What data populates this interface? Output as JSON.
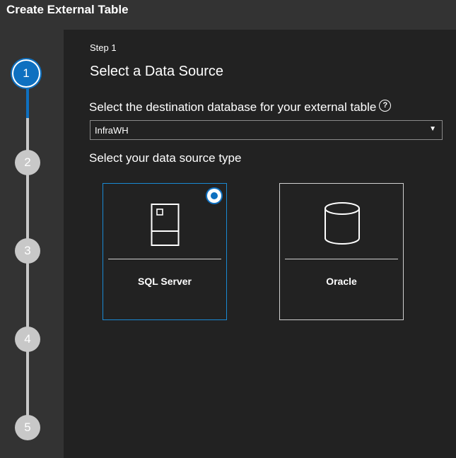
{
  "window": {
    "title": "Create External Table"
  },
  "stepper": {
    "steps": [
      {
        "number": "1",
        "state": "current"
      },
      {
        "number": "2",
        "state": "pending"
      },
      {
        "number": "3",
        "state": "pending"
      },
      {
        "number": "4",
        "state": "pending"
      },
      {
        "number": "5",
        "state": "pending"
      }
    ]
  },
  "main": {
    "step_label": "Step 1",
    "section_title": "Select a Data Source",
    "database_prompt": "Select the destination database for your external table",
    "database_select": {
      "value": "InfraWH",
      "icon": "chevron-down-icon"
    },
    "source_type_prompt": "Select your data source type",
    "sources": [
      {
        "label": "SQL Server",
        "icon": "sql-server-icon",
        "selected": true
      },
      {
        "label": "Oracle",
        "icon": "database-cylinder-icon",
        "selected": false
      }
    ]
  },
  "colors": {
    "accent": "#0e70c0",
    "panel_bg": "#222222",
    "chrome_bg": "#333333",
    "step_inactive": "#c8c8c8"
  }
}
